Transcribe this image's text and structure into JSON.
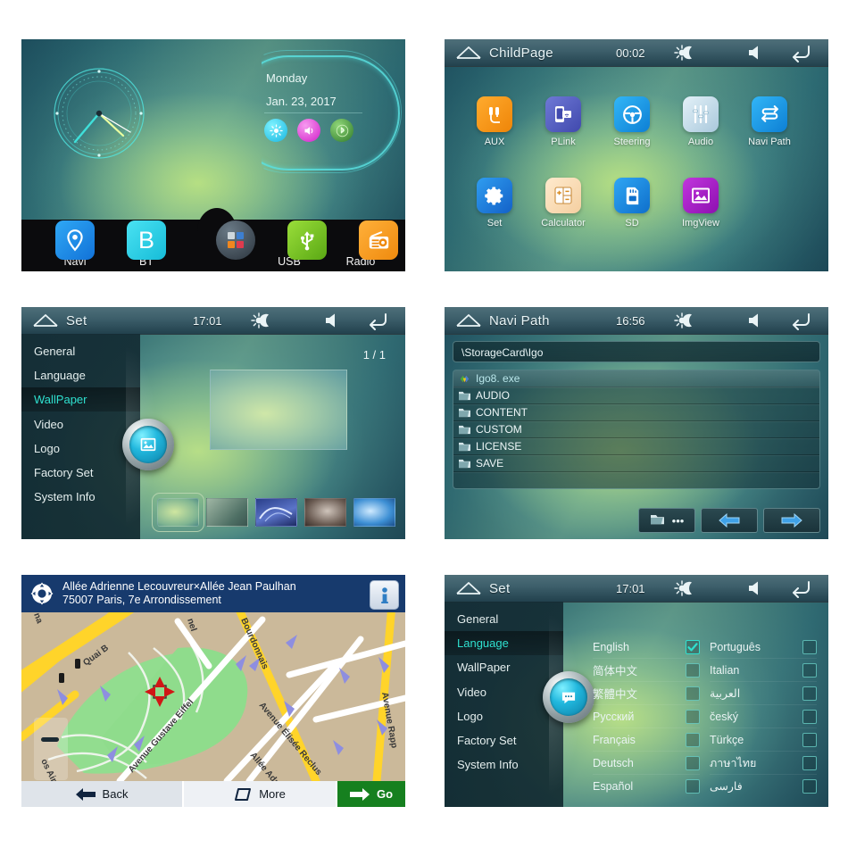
{
  "panels": {
    "home": {
      "name": "home-screen",
      "day": "Monday",
      "date": "Jan. 23, 2017",
      "quick_toggles": [
        {
          "name": "brightness-toggle",
          "icon": "sun-icon",
          "color": "#18b6e0"
        },
        {
          "name": "volume-toggle",
          "icon": "speaker-icon",
          "color": "#d11ec8"
        },
        {
          "name": "bluetooth-toggle",
          "icon": "bluetooth-icon",
          "color": "#2f7a2a"
        }
      ],
      "dock": [
        {
          "label": "Navi",
          "icon": "map-pin-icon",
          "color": "#1b9bf0"
        },
        {
          "label": "BT",
          "icon": "bluetooth-b-icon",
          "color": "#2ecfe8"
        },
        {
          "label": "",
          "icon": "apps-grid-icon",
          "color": "#3a4752"
        },
        {
          "label": "USB",
          "icon": "usb-icon",
          "color": "#78c224"
        },
        {
          "label": "Radio",
          "icon": "radio-icon",
          "color": "#f0971a"
        }
      ]
    },
    "childpage": {
      "statusbar": {
        "home_icon": "home-icon",
        "title": "ChildPage",
        "clock": "00:02",
        "brightness_icon": "brightness-icon",
        "volume_icon": "volume-icon",
        "back_icon": "back-arrow-icon"
      },
      "apps": [
        {
          "label": "AUX",
          "icon": "aux-plug-icon",
          "color": "#f0941b"
        },
        {
          "label": "PLink",
          "icon": "phone-link-icon",
          "color": "#5560c8"
        },
        {
          "label": "Steering",
          "icon": "steering-wheel-icon",
          "color": "#1fa0ee"
        },
        {
          "label": "Audio",
          "icon": "equalizer-icon",
          "color": "#bcd9e8"
        },
        {
          "label": "Navi Path",
          "icon": "route-icon",
          "color": "#1fa0ee"
        },
        {
          "label": "Set",
          "icon": "gear-icon",
          "color": "#1c7fe0"
        },
        {
          "label": "Calculator",
          "icon": "calculator-icon",
          "color": "#f6d9b2"
        },
        {
          "label": "SD",
          "icon": "sd-card-icon",
          "color": "#1b8fe6"
        },
        {
          "label": "ImgView",
          "icon": "image-icon",
          "color": "#a520c0"
        }
      ]
    },
    "set_wallpaper": {
      "statusbar": {
        "home_icon": "home-icon",
        "title": "Set",
        "clock": "17:01",
        "brightness_icon": "brightness-icon",
        "volume_icon": "volume-icon",
        "back_icon": "back-arrow-icon"
      },
      "menu": [
        "General",
        "Language",
        "WallPaper",
        "Video",
        "Logo",
        "Factory Set",
        "System Info"
      ],
      "active_menu": "WallPaper",
      "knob_icon": "image-icon",
      "page_indicator": "1 / 1",
      "thumbnails": [
        {
          "name": "wallpaper-thumb-1",
          "selected": true
        },
        {
          "name": "wallpaper-thumb-2",
          "selected": false
        },
        {
          "name": "wallpaper-thumb-3",
          "selected": false
        },
        {
          "name": "wallpaper-thumb-4",
          "selected": false
        },
        {
          "name": "wallpaper-thumb-5",
          "selected": false
        }
      ]
    },
    "navi_path": {
      "statusbar": {
        "home_icon": "home-icon",
        "title": "Navi Path",
        "clock": "16:56",
        "brightness_icon": "brightness-icon",
        "volume_icon": "volume-icon",
        "back_icon": "back-arrow-icon"
      },
      "path_value": "\\StorageCard\\Igo",
      "entries": [
        {
          "name": "Igo8. exe",
          "icon": "exe-icon",
          "selected": true
        },
        {
          "name": "AUDIO",
          "icon": "folder-icon",
          "selected": false
        },
        {
          "name": "CONTENT",
          "icon": "folder-icon",
          "selected": false
        },
        {
          "name": "CUSTOM",
          "icon": "folder-icon",
          "selected": false
        },
        {
          "name": "LICENSE",
          "icon": "folder-icon",
          "selected": false
        },
        {
          "name": "SAVE",
          "icon": "folder-icon",
          "selected": false
        }
      ],
      "buttons": [
        {
          "name": "browse-folder-button",
          "icon": "folder-ellipsis-icon"
        },
        {
          "name": "previous-button",
          "icon": "left-arrow-icon"
        },
        {
          "name": "next-button",
          "icon": "right-arrow-icon"
        }
      ]
    },
    "map": {
      "crosshair_icon": "crosshair-icon",
      "address_line1": "Allée Adrienne Lecouvreur×Allée Jean Paulhan",
      "address_line2": "75007 Paris, 7e Arrondissement",
      "info_icon": "info-icon",
      "street_labels": [
        "Quai B",
        "Bourdonnais",
        "Avenue Gustave Eiffel",
        "Avenue Élisée Reclus",
        "Allée Adrienne",
        "Avenue Rapp",
        "os Aires",
        "nel",
        "na"
      ],
      "buttons": [
        {
          "label": "Back",
          "icon": "left-arrow-icon",
          "name": "map-back-button"
        },
        {
          "label": "More",
          "icon": "more-icon",
          "name": "map-more-button"
        },
        {
          "label": "Go",
          "icon": "right-arrow-icon",
          "name": "map-go-button"
        }
      ]
    },
    "set_language": {
      "statusbar": {
        "home_icon": "home-icon",
        "title": "Set",
        "clock": "17:01",
        "brightness_icon": "brightness-icon",
        "volume_icon": "volume-icon",
        "back_icon": "back-arrow-icon"
      },
      "menu": [
        "General",
        "Language",
        "WallPaper",
        "Video",
        "Logo",
        "Factory Set",
        "System Info"
      ],
      "active_menu": "Language",
      "knob_icon": "chat-bubble-icon",
      "languages_left": [
        {
          "label": "English",
          "checked": true
        },
        {
          "label": "简体中文",
          "checked": false
        },
        {
          "label": "繁體中文",
          "checked": false
        },
        {
          "label": "Русский",
          "checked": false
        },
        {
          "label": "Français",
          "checked": false
        },
        {
          "label": "Deutsch",
          "checked": false
        },
        {
          "label": "Español",
          "checked": false
        }
      ],
      "languages_right": [
        {
          "label": "Português",
          "checked": false
        },
        {
          "label": "Italian",
          "checked": false
        },
        {
          "label": "العربية",
          "checked": false
        },
        {
          "label": "český",
          "checked": false
        },
        {
          "label": "Türkçe",
          "checked": false
        },
        {
          "label": "ภาษาไทย",
          "checked": false
        },
        {
          "label": "فارسی",
          "checked": false
        }
      ]
    }
  },
  "colors": {
    "accent_teal": "#2fe0cf",
    "statusbar": "#3d5f6b",
    "map_header": "#173a6d",
    "go_green": "#16801f"
  }
}
